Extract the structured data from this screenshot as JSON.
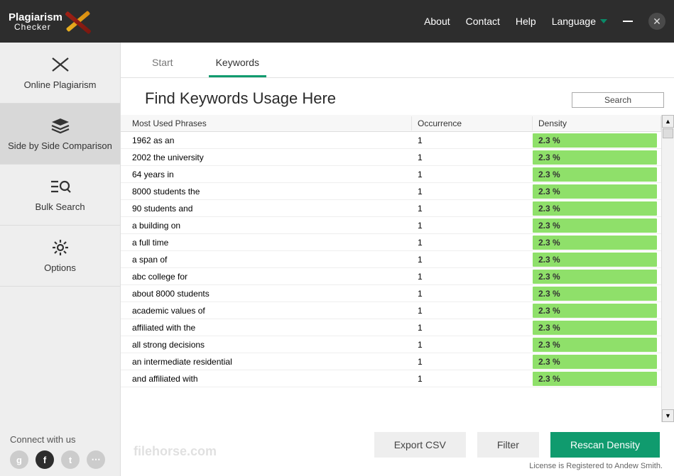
{
  "app": {
    "name_line1": "Plagiarism",
    "name_line2": "Checker"
  },
  "nav": {
    "about": "About",
    "contact": "Contact",
    "help": "Help",
    "language": "Language"
  },
  "sidebar": {
    "items": [
      {
        "label": "Online Plagiarism"
      },
      {
        "label": "Side by Side Comparison"
      },
      {
        "label": "Bulk Search"
      },
      {
        "label": "Options"
      }
    ],
    "connect": "Connect with us"
  },
  "tabs": {
    "start": "Start",
    "keywords": "Keywords"
  },
  "main": {
    "title": "Find Keywords Usage Here",
    "search_label": "Search"
  },
  "table": {
    "headers": {
      "phrase": "Most Used Phrases",
      "occurrence": "Occurrence",
      "density": "Density"
    },
    "rows": [
      {
        "phrase": "1962 as an",
        "occurrence": "1",
        "density": "2.3 %"
      },
      {
        "phrase": "2002 the university",
        "occurrence": "1",
        "density": "2.3 %"
      },
      {
        "phrase": "64 years in",
        "occurrence": "1",
        "density": "2.3 %"
      },
      {
        "phrase": "8000 students the",
        "occurrence": "1",
        "density": "2.3 %"
      },
      {
        "phrase": "90 students and",
        "occurrence": "1",
        "density": "2.3 %"
      },
      {
        "phrase": "a building on",
        "occurrence": "1",
        "density": "2.3 %"
      },
      {
        "phrase": "a full time",
        "occurrence": "1",
        "density": "2.3 %"
      },
      {
        "phrase": "a span of",
        "occurrence": "1",
        "density": "2.3 %"
      },
      {
        "phrase": "abc college for",
        "occurrence": "1",
        "density": "2.3 %"
      },
      {
        "phrase": "about 8000 students",
        "occurrence": "1",
        "density": "2.3 %"
      },
      {
        "phrase": "academic values of",
        "occurrence": "1",
        "density": "2.3 %"
      },
      {
        "phrase": "affiliated with the",
        "occurrence": "1",
        "density": "2.3 %"
      },
      {
        "phrase": "all strong decisions",
        "occurrence": "1",
        "density": "2.3 %"
      },
      {
        "phrase": "an intermediate residential",
        "occurrence": "1",
        "density": "2.3 %"
      },
      {
        "phrase": "and affiliated with",
        "occurrence": "1",
        "density": "2.3 %"
      }
    ]
  },
  "footer": {
    "export_csv": "Export CSV",
    "filter": "Filter",
    "rescan": "Rescan Density",
    "license": "License is Registered to Andew Smith."
  },
  "watermark": "filehorse.com"
}
